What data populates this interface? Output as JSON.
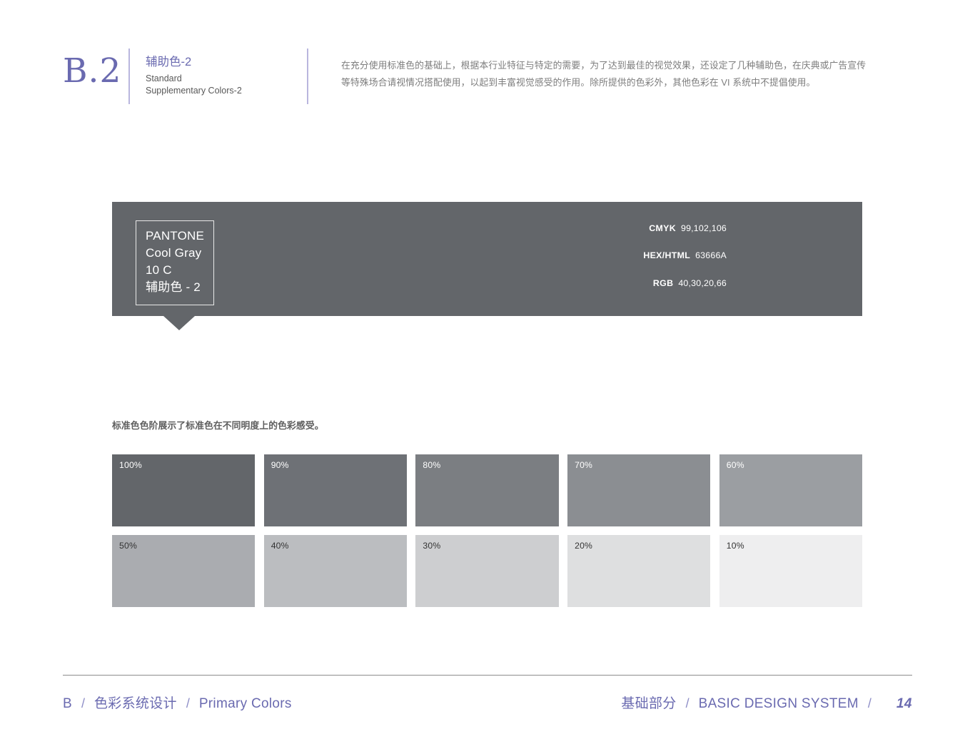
{
  "header": {
    "section_code": "B.2",
    "title_cn": "辅助色-2",
    "title_en_line1": "Standard",
    "title_en_line2": "Supplementary Colors-2",
    "description_line1": "在充分使用标准色的基础上，根据本行业特征与特定的需要，为了达到最佳的视觉效果，还设定了几种辅助色，在庆典或广告宣传",
    "description_line2": "等特殊场合请视情况搭配使用，以起到丰富视觉感受的作用。除所提供的色彩外，其他色彩在 VI 系统中不提倡使用。"
  },
  "color_block": {
    "background": "#63666A",
    "pantone": {
      "line1": "PANTONE",
      "line2": "Cool Gray",
      "line3": "10 C",
      "line4": "辅助色 - 2"
    },
    "specs": [
      {
        "label": "CMYK",
        "value": "99,102,106"
      },
      {
        "label": "HEX/HTML",
        "value": "63666A"
      },
      {
        "label": "RGB",
        "value": "40,30,20,66"
      }
    ]
  },
  "tints": {
    "caption": "标准色色阶展示了标准色在不同明度上的色彩感受。",
    "swatches": [
      {
        "label": "100%",
        "color": "#63666A",
        "text_color": "#ffffff"
      },
      {
        "label": "90%",
        "color": "#6e7176",
        "text_color": "#ffffff"
      },
      {
        "label": "80%",
        "color": "#7b7e82",
        "text_color": "#ffffff"
      },
      {
        "label": "70%",
        "color": "#8b8e92",
        "text_color": "#ffffff"
      },
      {
        "label": "60%",
        "color": "#9b9ea2",
        "text_color": "#ffffff"
      },
      {
        "label": "50%",
        "color": "#aaacb0",
        "text_color": "#333333"
      },
      {
        "label": "40%",
        "color": "#bbbdc0",
        "text_color": "#333333"
      },
      {
        "label": "30%",
        "color": "#cdced0",
        "text_color": "#333333"
      },
      {
        "label": "20%",
        "color": "#dedfe0",
        "text_color": "#333333"
      },
      {
        "label": "10%",
        "color": "#eeeeef",
        "text_color": "#333333"
      }
    ]
  },
  "footer": {
    "left": {
      "code": "B",
      "sep1": "/",
      "label_cn": "色彩系统设计",
      "sep2": "/",
      "label_en": "Primary Colors"
    },
    "right": {
      "label_cn": "基础部分",
      "sep1": "/",
      "label_en": "BASIC DESIGN SYSTEM",
      "sep2": "/",
      "page": "14"
    }
  },
  "theme": {
    "accent_purple": "#6a6ab0",
    "divider_purple": "#b9b6de",
    "primary_gray": "#63666A"
  }
}
